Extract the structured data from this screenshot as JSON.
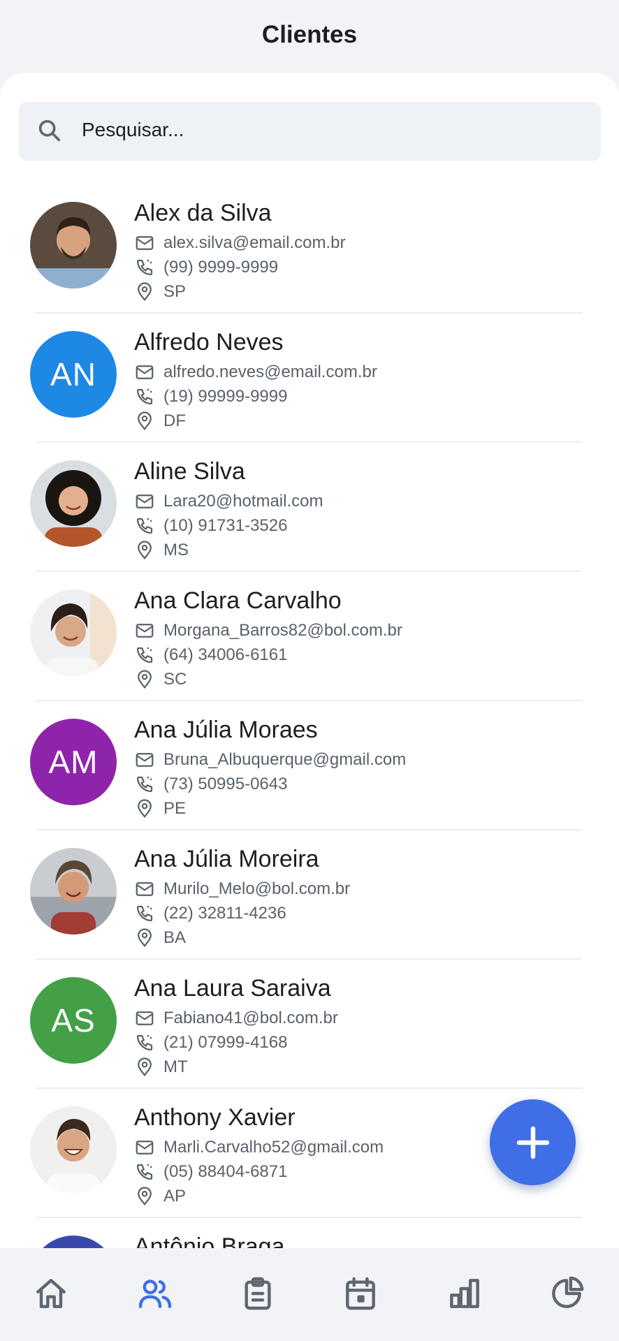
{
  "header": {
    "title": "Clientes"
  },
  "search": {
    "placeholder": "Pesquisar..."
  },
  "clients": [
    {
      "name": "Alex da Silva",
      "email": "alex.silva@email.com.br",
      "phone": "(99) 9999-9999",
      "state": "SP",
      "avatar_type": "photo"
    },
    {
      "name": "Alfredo Neves",
      "email": "alfredo.neves@email.com.br",
      "phone": "(19) 99999-9999",
      "state": "DF",
      "avatar_type": "initials",
      "initials": "AN",
      "avatar_color": "#1e88e5"
    },
    {
      "name": "Aline Silva",
      "email": "Lara20@hotmail.com",
      "phone": "(10) 91731-3526",
      "state": "MS",
      "avatar_type": "photo"
    },
    {
      "name": "Ana Clara Carvalho",
      "email": "Morgana_Barros82@bol.com.br",
      "phone": "(64) 34006-6161",
      "state": "SC",
      "avatar_type": "photo"
    },
    {
      "name": "Ana Júlia Moraes",
      "email": "Bruna_Albuquerque@gmail.com",
      "phone": "(73) 50995-0643",
      "state": "PE",
      "avatar_type": "initials",
      "initials": "AM",
      "avatar_color": "#8e24aa"
    },
    {
      "name": "Ana Júlia Moreira",
      "email": "Murilo_Melo@bol.com.br",
      "phone": "(22) 32811-4236",
      "state": "BA",
      "avatar_type": "photo"
    },
    {
      "name": "Ana Laura Saraiva",
      "email": "Fabiano41@bol.com.br",
      "phone": "(21) 07999-4168",
      "state": "MT",
      "avatar_type": "initials",
      "initials": "AS",
      "avatar_color": "#43a047"
    },
    {
      "name": "Anthony Xavier",
      "email": "Marli.Carvalho52@gmail.com",
      "phone": "(05) 88404-6871",
      "state": "AP",
      "avatar_type": "photo"
    },
    {
      "name": "Antônio Braga",
      "avatar_type": "initials",
      "avatar_color": "#3949ab"
    }
  ],
  "fab": {
    "icon": "plus-icon",
    "color": "#3f6ee7"
  },
  "bottom_nav": {
    "active": "clients",
    "active_color": "#3f6ee7",
    "inactive_color": "#5f6670",
    "items": [
      {
        "id": "home",
        "icon": "home-icon"
      },
      {
        "id": "clients",
        "icon": "users-icon"
      },
      {
        "id": "orders",
        "icon": "clipboard-icon"
      },
      {
        "id": "calendar",
        "icon": "calendar-icon"
      },
      {
        "id": "reports",
        "icon": "bar-chart-icon"
      },
      {
        "id": "analytics",
        "icon": "pie-chart-icon"
      }
    ]
  }
}
